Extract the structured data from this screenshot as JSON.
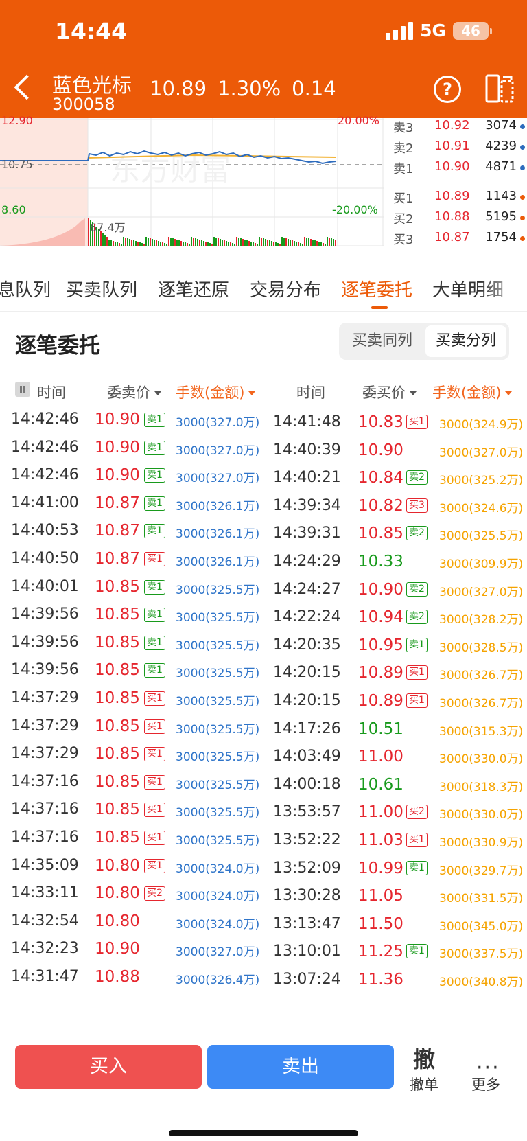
{
  "status": {
    "time": "14:44",
    "network": "5G",
    "battery": "46"
  },
  "stock": {
    "name": "蓝色光标",
    "code": "300058",
    "price": "10.89",
    "change_pct": "1.30%",
    "change": "0.14"
  },
  "chart": {
    "price_high": "12.90",
    "price_mid": "10.75",
    "price_low": "8.60",
    "pct_high": "20.00%",
    "pct_low": "-20.00%",
    "volume_peak": "67.4万",
    "watermark": "东方财富",
    "colors": {
      "up": "#e5262e",
      "down": "#189a1c",
      "price_line": "#2d6bbd",
      "avg_line": "#f2b233"
    }
  },
  "orderbook": {
    "asks": [
      {
        "label": "卖3",
        "price": "10.92",
        "vol": "3074"
      },
      {
        "label": "卖2",
        "price": "10.91",
        "vol": "4239"
      },
      {
        "label": "卖1",
        "price": "10.90",
        "vol": "4871"
      }
    ],
    "bids": [
      {
        "label": "买1",
        "price": "10.89",
        "vol": "1143"
      },
      {
        "label": "买2",
        "price": "10.88",
        "vol": "5195"
      },
      {
        "label": "买3",
        "price": "10.87",
        "vol": "1754"
      }
    ]
  },
  "tabs": [
    "息队列",
    "买卖队列",
    "逐笔还原",
    "交易分布",
    "逐笔委托",
    "大单明细"
  ],
  "active_tab": "逐笔委托",
  "section": {
    "title": "逐笔委托",
    "segment_options": [
      "买卖同列",
      "买卖分列"
    ],
    "segment_selected": "买卖分列"
  },
  "columns": {
    "left": {
      "time": "时间",
      "price": "委卖价",
      "amount": "手数(金额)"
    },
    "right": {
      "time": "时间",
      "price": "委买价",
      "amount": "手数(金额)"
    }
  },
  "sell_orders": [
    {
      "time": "14:42:46",
      "price": "10.90",
      "tag": "卖1",
      "amount": "3000(327.0万)"
    },
    {
      "time": "14:42:46",
      "price": "10.90",
      "tag": "卖1",
      "amount": "3000(327.0万)"
    },
    {
      "time": "14:42:46",
      "price": "10.90",
      "tag": "卖1",
      "amount": "3000(327.0万)"
    },
    {
      "time": "14:41:00",
      "price": "10.87",
      "tag": "卖1",
      "amount": "3000(326.1万)"
    },
    {
      "time": "14:40:53",
      "price": "10.87",
      "tag": "卖1",
      "amount": "3000(326.1万)"
    },
    {
      "time": "14:40:50",
      "price": "10.87",
      "tag": "买1",
      "amount": "3000(326.1万)"
    },
    {
      "time": "14:40:01",
      "price": "10.85",
      "tag": "卖1",
      "amount": "3000(325.5万)"
    },
    {
      "time": "14:39:56",
      "price": "10.85",
      "tag": "卖1",
      "amount": "3000(325.5万)"
    },
    {
      "time": "14:39:56",
      "price": "10.85",
      "tag": "卖1",
      "amount": "3000(325.5万)"
    },
    {
      "time": "14:39:56",
      "price": "10.85",
      "tag": "卖1",
      "amount": "3000(325.5万)"
    },
    {
      "time": "14:37:29",
      "price": "10.85",
      "tag": "买1",
      "amount": "3000(325.5万)"
    },
    {
      "time": "14:37:29",
      "price": "10.85",
      "tag": "买1",
      "amount": "3000(325.5万)"
    },
    {
      "time": "14:37:29",
      "price": "10.85",
      "tag": "买1",
      "amount": "3000(325.5万)"
    },
    {
      "time": "14:37:16",
      "price": "10.85",
      "tag": "买1",
      "amount": "3000(325.5万)"
    },
    {
      "time": "14:37:16",
      "price": "10.85",
      "tag": "买1",
      "amount": "3000(325.5万)"
    },
    {
      "time": "14:37:16",
      "price": "10.85",
      "tag": "买1",
      "amount": "3000(325.5万)"
    },
    {
      "time": "14:35:09",
      "price": "10.80",
      "tag": "买1",
      "amount": "3000(324.0万)"
    },
    {
      "time": "14:33:11",
      "price": "10.80",
      "tag": "买2",
      "amount": "3000(324.0万)"
    },
    {
      "time": "14:32:54",
      "price": "10.80",
      "tag": "",
      "amount": "3000(324.0万)"
    },
    {
      "time": "14:32:23",
      "price": "10.90",
      "tag": "",
      "amount": "3000(327.0万)"
    },
    {
      "time": "14:31:47",
      "price": "10.88",
      "tag": "",
      "amount": "3000(326.4万)"
    }
  ],
  "buy_orders": [
    {
      "time": "14:41:48",
      "price": "10.83",
      "dir": "up",
      "tag": "买1",
      "amount": "3000(324.9万)"
    },
    {
      "time": "14:40:39",
      "price": "10.90",
      "dir": "up",
      "tag": "",
      "amount": "3000(327.0万)"
    },
    {
      "time": "14:40:21",
      "price": "10.84",
      "dir": "up",
      "tag": "卖2",
      "amount": "3000(325.2万)"
    },
    {
      "time": "14:39:34",
      "price": "10.82",
      "dir": "up",
      "tag": "买3",
      "amount": "3000(324.6万)"
    },
    {
      "time": "14:39:31",
      "price": "10.85",
      "dir": "up",
      "tag": "卖2",
      "amount": "3000(325.5万)"
    },
    {
      "time": "14:24:29",
      "price": "10.33",
      "dir": "down",
      "tag": "",
      "amount": "3000(309.9万)"
    },
    {
      "time": "14:24:27",
      "price": "10.90",
      "dir": "up",
      "tag": "卖2",
      "amount": "3000(327.0万)"
    },
    {
      "time": "14:22:24",
      "price": "10.94",
      "dir": "up",
      "tag": "卖2",
      "amount": "3000(328.2万)"
    },
    {
      "time": "14:20:35",
      "price": "10.95",
      "dir": "up",
      "tag": "卖1",
      "amount": "3000(328.5万)"
    },
    {
      "time": "14:20:15",
      "price": "10.89",
      "dir": "up",
      "tag": "买1",
      "amount": "3000(326.7万)"
    },
    {
      "time": "14:20:15",
      "price": "10.89",
      "dir": "up",
      "tag": "买1",
      "amount": "3000(326.7万)"
    },
    {
      "time": "14:17:26",
      "price": "10.51",
      "dir": "down",
      "tag": "",
      "amount": "3000(315.3万)"
    },
    {
      "time": "14:03:49",
      "price": "11.00",
      "dir": "up",
      "tag": "",
      "amount": "3000(330.0万)"
    },
    {
      "time": "14:00:18",
      "price": "10.61",
      "dir": "down",
      "tag": "",
      "amount": "3000(318.3万)"
    },
    {
      "time": "13:53:57",
      "price": "11.00",
      "dir": "up",
      "tag": "买2",
      "amount": "3000(330.0万)"
    },
    {
      "time": "13:52:22",
      "price": "11.03",
      "dir": "up",
      "tag": "买1",
      "amount": "3000(330.9万)"
    },
    {
      "time": "13:52:09",
      "price": "10.99",
      "dir": "up",
      "tag": "卖1",
      "amount": "3000(329.7万)"
    },
    {
      "time": "13:30:28",
      "price": "11.05",
      "dir": "up",
      "tag": "",
      "amount": "3000(331.5万)"
    },
    {
      "time": "13:13:47",
      "price": "11.50",
      "dir": "up",
      "tag": "",
      "amount": "3000(345.0万)"
    },
    {
      "time": "13:10:01",
      "price": "11.25",
      "dir": "up",
      "tag": "卖1",
      "amount": "3000(337.5万)"
    },
    {
      "time": "13:07:24",
      "price": "11.36",
      "dir": "up",
      "tag": "",
      "amount": "3000(340.8万)"
    }
  ],
  "bottom": {
    "buy": "买入",
    "sell": "卖出",
    "undo_glyph": "撤",
    "undo": "撤单",
    "more": "更多"
  }
}
